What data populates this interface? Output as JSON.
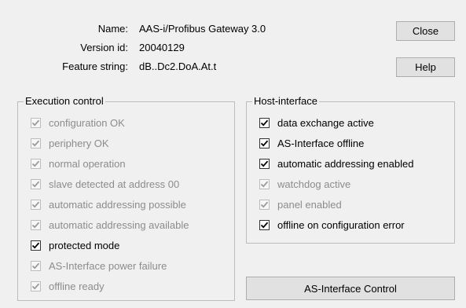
{
  "info": {
    "name_label": "Name:",
    "name_value": "AAS-i/Profibus Gateway 3.0",
    "version_label": "Version id:",
    "version_value": "20040129",
    "feature_label": "Feature string:",
    "feature_value": "dB..Dc2.DoA.At.t"
  },
  "buttons": {
    "close": "Close",
    "help": "Help",
    "asi_control": "AS-Interface Control"
  },
  "execution_control": {
    "title": "Execution control",
    "items": [
      {
        "label": "configuration OK",
        "checked": false,
        "enabled": false
      },
      {
        "label": "periphery OK",
        "checked": true,
        "enabled": false
      },
      {
        "label": "normal operation",
        "checked": true,
        "enabled": false
      },
      {
        "label": "slave detected at address 00",
        "checked": false,
        "enabled": false
      },
      {
        "label": "automatic addressing possible",
        "checked": false,
        "enabled": false
      },
      {
        "label": "automatic addressing available",
        "checked": false,
        "enabled": false
      },
      {
        "label": "protected mode",
        "checked": true,
        "enabled": true
      },
      {
        "label": "AS-Interface power failure",
        "checked": false,
        "enabled": false
      },
      {
        "label": "offline ready",
        "checked": false,
        "enabled": false
      }
    ]
  },
  "host_interface": {
    "title": "Host-interface",
    "items": [
      {
        "label": "data exchange active",
        "checked": true,
        "enabled": true
      },
      {
        "label": "AS-Interface offline",
        "checked": false,
        "enabled": true
      },
      {
        "label": "automatic addressing enabled",
        "checked": true,
        "enabled": true
      },
      {
        "label": "watchdog active",
        "checked": false,
        "enabled": false
      },
      {
        "label": "panel enabled",
        "checked": true,
        "enabled": false
      },
      {
        "label": "offline on configuration error",
        "checked": false,
        "enabled": true
      }
    ]
  }
}
